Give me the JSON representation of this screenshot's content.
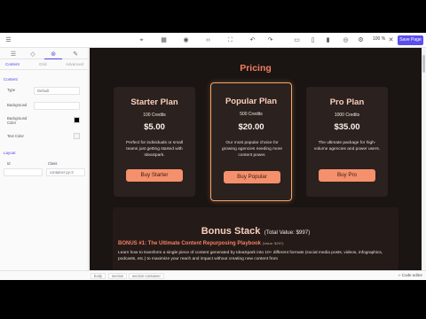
{
  "toolbar": {
    "zoom": "100 %",
    "save_label": "Save Page"
  },
  "panel": {
    "subtabs": [
      "Content",
      "Grid",
      "Advanced"
    ],
    "content_section": "Content",
    "type_label": "Type",
    "type_value": "Default",
    "background_label": "Background",
    "background_color_label": "Background Color",
    "text_color_label": "Text Color",
    "colors": {
      "background_color": "#000000",
      "text_color": "#f4f4f5"
    },
    "layout_section": "Layout",
    "id_label": "Id",
    "class_label": "Class",
    "class_value": "container py-3"
  },
  "canvas": {
    "pricing_title": "Pricing",
    "cards": [
      {
        "name": "Starter Plan",
        "credits": "100 Credits",
        "price": "$5.00",
        "description": "Perfect for individuals or small teams just getting started with IdeaSpark.",
        "button": "Buy Starter"
      },
      {
        "name": "Popular Plan",
        "credits": "500 Credits",
        "price": "$20.00",
        "description": "Our most popular choice for growing agencies needing more content power.",
        "button": "Buy Popular"
      },
      {
        "name": "Pro Plan",
        "credits": "1000 Credits",
        "price": "$35.00",
        "description": "The ultimate package for high-volume agencies and power users.",
        "button": "Buy Pro"
      }
    ],
    "bonus_title": "Bonus Stack",
    "bonus_total": "(Total Value: $997)",
    "bonus1_title": "BONUS #1: The Ultimate Content Repurposing Playbook",
    "bonus1_value": "(Value: $297)",
    "bonus1_desc": "Learn how to transform a single piece of content generated by IdeaSpark into 10+ different formats (social media posts, videos, infographics, podcasts, etc.) to maximize your reach and impact without creating new content from"
  },
  "statusbar": {
    "crumbs": [
      "body",
      "section",
      "section-container"
    ],
    "code_editor": "Code editor"
  },
  "colors": {
    "accent": "#5b4ff0",
    "pricing_title": "#f57e62",
    "card_bg": "#2b211e",
    "button": "#f5906c",
    "canvas_bg": "#1a1412"
  }
}
